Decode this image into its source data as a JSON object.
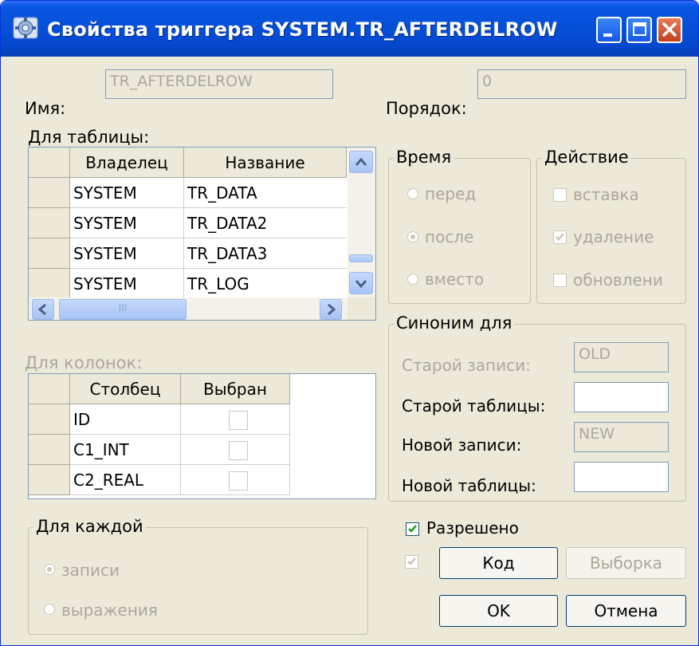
{
  "window": {
    "title": "Свойства триггера SYSTEM.TR_AFTERDELROW"
  },
  "name_label": "Имя:",
  "name_value": "TR_AFTERDELROW",
  "order_label": "Порядок:",
  "order_value": "0",
  "table_section_label": "Для таблицы:",
  "tables": {
    "headers": [
      "Владелец",
      "Название"
    ],
    "rows": [
      {
        "owner": "SYSTEM",
        "name": "TR_DATA"
      },
      {
        "owner": "SYSTEM",
        "name": "TR_DATA2"
      },
      {
        "owner": "SYSTEM",
        "name": "TR_DATA3"
      },
      {
        "owner": "SYSTEM",
        "name": "TR_LOG"
      }
    ]
  },
  "columns_section_label": "Для колонок:",
  "columns": {
    "headers": [
      "Столбец",
      "Выбран"
    ],
    "rows": [
      {
        "name": "ID",
        "selected": false
      },
      {
        "name": "C1_INT",
        "selected": false
      },
      {
        "name": "C2_REAL",
        "selected": false
      }
    ]
  },
  "time_group": {
    "title": "Время",
    "options": [
      "перед",
      "после",
      "вместо"
    ],
    "selected": "после"
  },
  "action_group": {
    "title": "Действие",
    "options": [
      {
        "label": "вставка",
        "checked": false
      },
      {
        "label": "удаление",
        "checked": true
      },
      {
        "label": "обновлени",
        "checked": false
      }
    ]
  },
  "synonym_group": {
    "title": "Синоним для",
    "old_record_label": "Старой записи:",
    "old_record_value": "OLD",
    "old_table_label": "Старой таблицы:",
    "old_table_value": "",
    "new_record_label": "Новой записи:",
    "new_record_value": "NEW",
    "new_table_label": "Новой таблицы:",
    "new_table_value": ""
  },
  "for_each_group": {
    "title": "Для каждой",
    "options": [
      "записи",
      "выражения"
    ],
    "selected": "записи"
  },
  "enabled": {
    "label": "Разрешено",
    "checked": true
  },
  "buttons": {
    "code": "Код",
    "selection": "Выборка",
    "ok": "OK",
    "cancel": "Отмена"
  },
  "scrollbar_thumb_glyph": "III"
}
